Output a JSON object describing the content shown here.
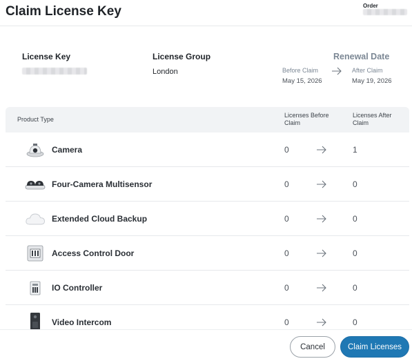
{
  "header": {
    "title": "Claim License Key",
    "order_label": "Order"
  },
  "info": {
    "license_key_label": "License Key",
    "license_group_label": "License Group",
    "license_group_value": "London",
    "renewal_label": "Renewal Date",
    "before_claim_label": "Before Claim",
    "before_claim_date": "May 15, 2026",
    "after_claim_label": "After Claim",
    "after_claim_date": "May 19, 2026"
  },
  "table": {
    "col_type": "Product Type",
    "col_before": "Licenses Before Claim",
    "col_after": "Licenses After Claim",
    "rows": [
      {
        "name": "Camera",
        "icon": "camera-icon",
        "before": "0",
        "after": "1"
      },
      {
        "name": "Four-Camera Multisensor",
        "icon": "multisensor-camera-icon",
        "before": "0",
        "after": "0"
      },
      {
        "name": "Extended Cloud Backup",
        "icon": "cloud-icon",
        "before": "0",
        "after": "0"
      },
      {
        "name": "Access Control Door",
        "icon": "access-control-icon",
        "before": "0",
        "after": "0"
      },
      {
        "name": "IO Controller",
        "icon": "io-controller-icon",
        "before": "0",
        "after": "0"
      },
      {
        "name": "Video Intercom",
        "icon": "video-intercom-icon",
        "before": "0",
        "after": "0"
      }
    ]
  },
  "footer": {
    "cancel_label": "Cancel",
    "claim_label": "Claim Licenses"
  },
  "colors": {
    "accent": "#1f78b4",
    "header_bg": "#f1f3f5",
    "muted": "#7b8794"
  }
}
